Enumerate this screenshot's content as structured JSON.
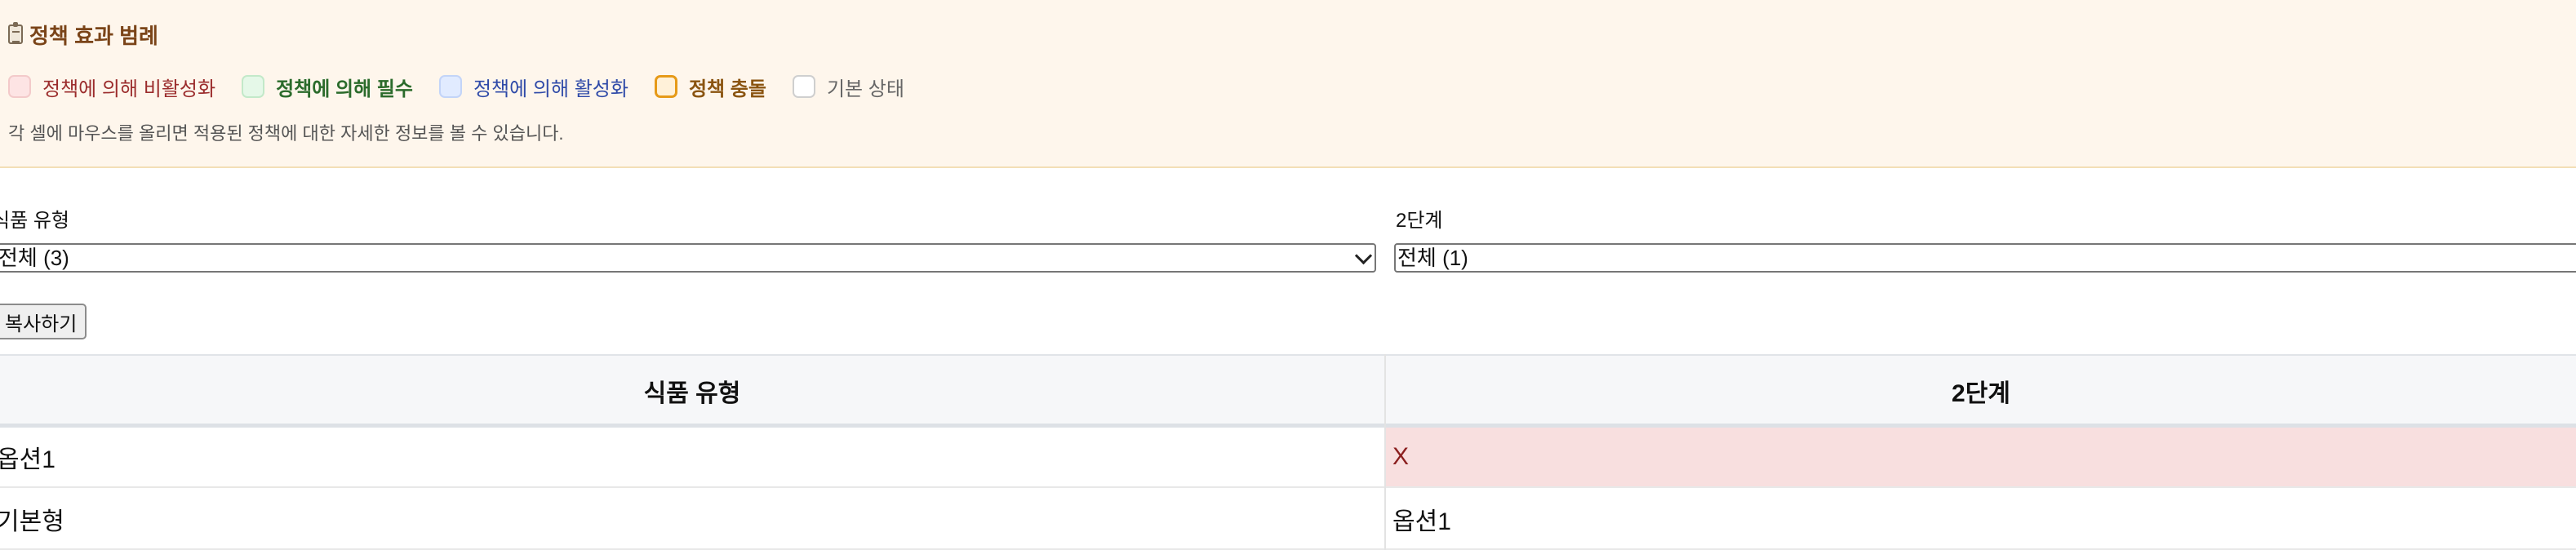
{
  "legend": {
    "title": "정책 효과 범례",
    "icon": "clipboard-icon",
    "items": [
      {
        "label": "정책에 의해 비활성화",
        "color": "#fde4e4"
      },
      {
        "label": "정책에 의해 필수",
        "color": "#e5f8e8"
      },
      {
        "label": "정책에 의해 활성화",
        "color": "#e1ebff"
      },
      {
        "label": "정책 충돌",
        "color": "#e69a18"
      },
      {
        "label": "기본 상태",
        "color": "#ffffff"
      }
    ],
    "hint": "각 셀에 마우스를 올리면 적용된 정책에 대한 자세한 정보를 볼 수 있습니다."
  },
  "filters": [
    {
      "label": "식품 유형",
      "value": "전체 (3)"
    },
    {
      "label": "2단계",
      "value": "전체 (1)"
    }
  ],
  "copy_button": "복사하기",
  "table": {
    "headers": [
      "식품 유형",
      "2단계"
    ],
    "rows": [
      [
        "옵션1",
        "X"
      ],
      [
        "기본형",
        "옵션1"
      ]
    ]
  }
}
